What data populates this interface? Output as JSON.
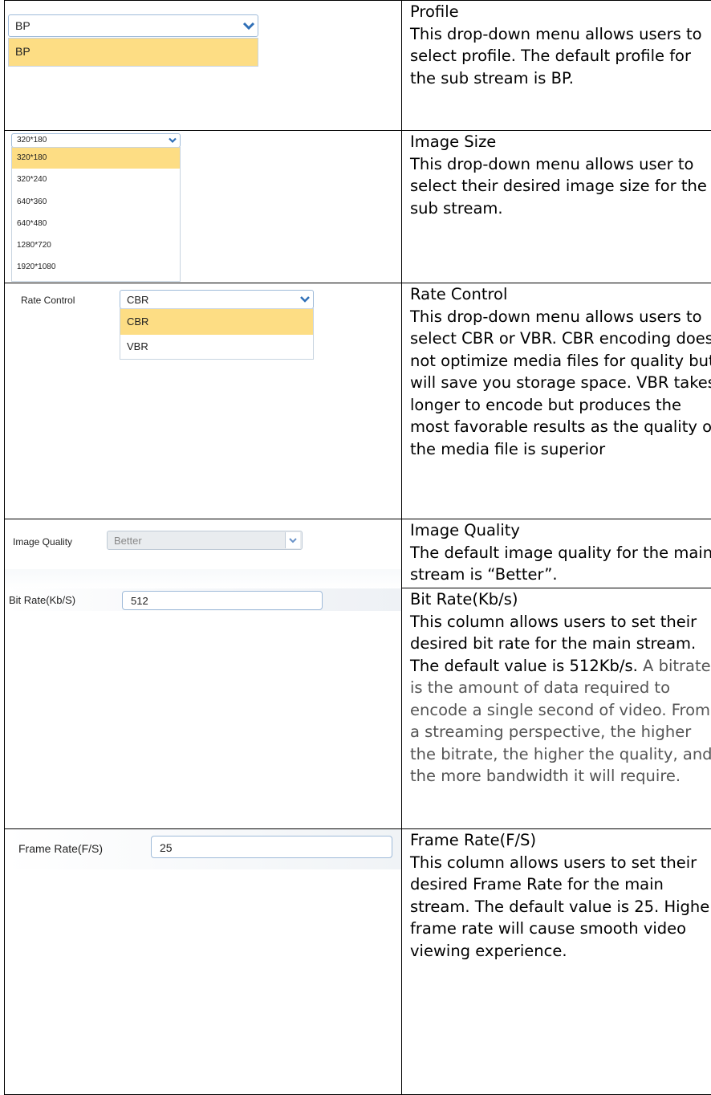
{
  "rows": [
    {
      "title": "Profile",
      "desc": "This drop-down menu allows users to select profile. The default profile for the sub stream is BP.",
      "ui": {
        "selected": "BP",
        "options": [
          "BP"
        ]
      }
    },
    {
      "title": "Image Size",
      "desc": "This drop-down menu allows user to select their desired image size for the sub stream.",
      "ui": {
        "selected": "320*180",
        "options": [
          "320*180",
          "320*240",
          "640*360",
          "640*480",
          "1280*720",
          "1920*1080"
        ]
      }
    },
    {
      "title": "Rate Control",
      "desc": "This drop-down menu allows users to select CBR or VBR.  CBR encoding does not optimize media files for quality but will save you storage space. VBR takes longer to encode but produces the most favorable results as the quality of the  media file is superior",
      "ui": {
        "label": "Rate Control",
        "selected": "CBR",
        "options": [
          "CBR",
          "VBR"
        ]
      }
    },
    {
      "title": "Image Quality",
      "desc": "The default image quality for the main stream is “Better”.",
      "ui": {
        "label": "Image Quality",
        "selected": "Better"
      }
    },
    {
      "title": "Bit Rate(Kb/s)",
      "desc": "This column allows users to set their desired bit rate for the main stream. The default value is 512Kb/s.",
      "desc_muted": " A bitrate is the amount of data required to encode a single second of video. From a streaming perspective, the higher the bitrate, the higher the quality, and the more bandwidth it will require.",
      "ui": {
        "label": "Bit Rate(Kb/S)",
        "value": "512"
      }
    },
    {
      "title": "Frame Rate(F/S)",
      "desc": "This column allows users to set their desired Frame Rate for the main stream. The default value is 25. Higher frame rate will cause smooth video viewing experience.",
      "ui": {
        "label": "Frame Rate(F/S)",
        "value": "25"
      }
    }
  ],
  "icons": {
    "dropdown": "chevron-down-icon"
  },
  "colors": {
    "highlight": "#fddd84",
    "border": "#9fbbd9",
    "chevron": "#2f6fb7"
  }
}
